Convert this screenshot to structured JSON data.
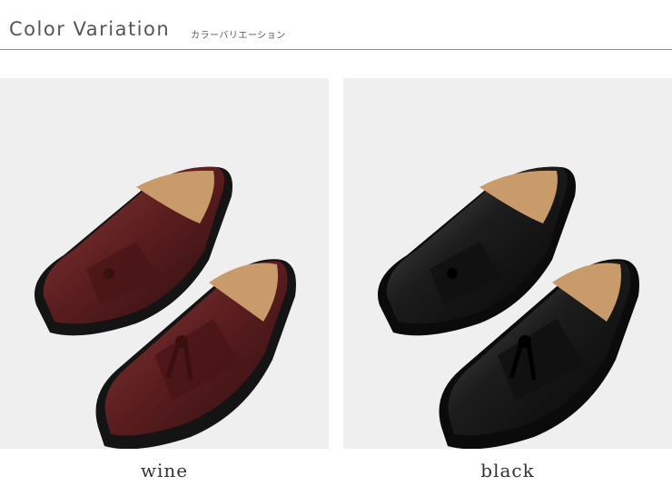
{
  "header": {
    "title": "Color Variation",
    "subtitle": "カラーバリエーション"
  },
  "variants": [
    {
      "label": "wine",
      "color": "#5a1d1f",
      "highlight": "#9b4a45",
      "sole": "#141414",
      "lining": "#c99a6a"
    },
    {
      "label": "black",
      "color": "#141414",
      "highlight": "#6a6a6a",
      "sole": "#0b0b0b",
      "lining": "#c99a6a"
    }
  ]
}
